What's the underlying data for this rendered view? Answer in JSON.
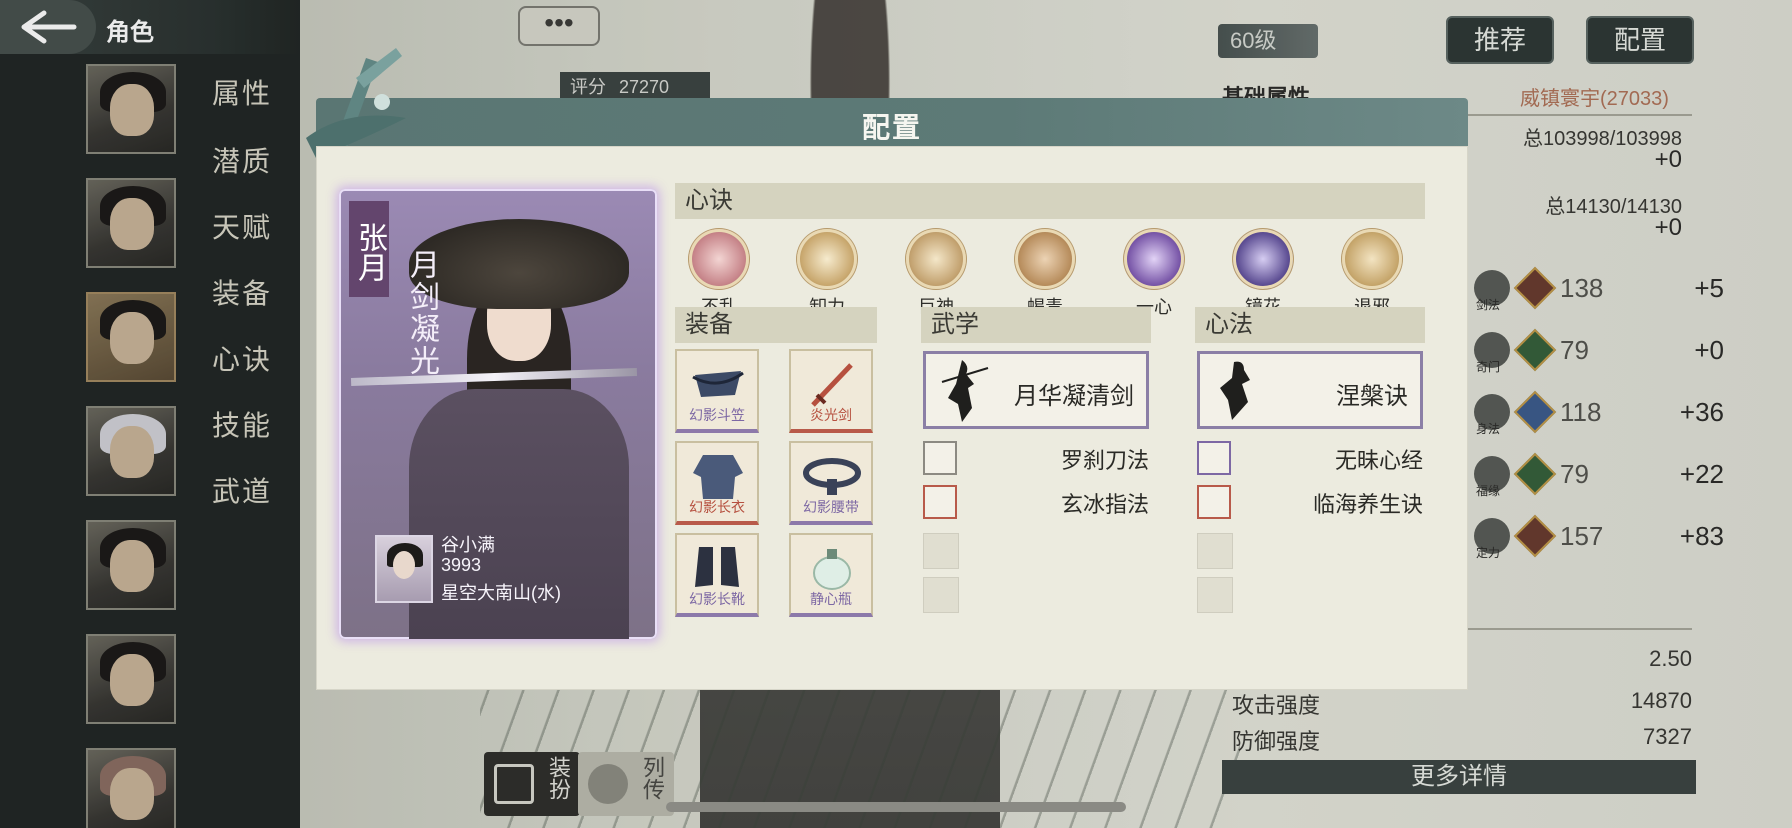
{
  "header": {
    "back_label": "角色"
  },
  "nav": {
    "items": [
      "属性",
      "潜质",
      "天赋",
      "装备",
      "心诀",
      "技能",
      "武道"
    ]
  },
  "stats_panel": {
    "level": "60级",
    "buttons": {
      "recommend": "推荐",
      "config": "配置"
    },
    "section_title": "基础属性",
    "title_right": "威镇寰宇(27033)",
    "rows": [
      {
        "total": "总103998/103998",
        "plus": "+0"
      },
      {
        "total": "总14130/14130",
        "plus": "+0"
      }
    ],
    "skills": [
      {
        "label": "剑法",
        "grade": "甲",
        "value": "138",
        "plus": "+5"
      },
      {
        "label": "奇门",
        "grade": "丙",
        "value": "79",
        "plus": "+0"
      },
      {
        "label": "身法",
        "grade": "",
        "value": "118",
        "plus": "+36"
      },
      {
        "label": "福缘",
        "grade": "丙",
        "value": "79",
        "plus": "+22"
      },
      {
        "label": "定力",
        "grade": "甲",
        "value": "157",
        "plus": "+83"
      }
    ],
    "details": [
      {
        "label": "",
        "value": "2.50"
      },
      {
        "label": "攻击强度",
        "value": "14870"
      },
      {
        "label": "防御强度",
        "value": "7327"
      }
    ],
    "more_details": "更多详情"
  },
  "score": {
    "label": "评分",
    "value": "27270"
  },
  "bottom_tabs": {
    "dress": "装扮",
    "biography": "列传"
  },
  "modal": {
    "title": "配置",
    "character": {
      "name": "张月",
      "title": "月剑凝光",
      "owner_name": "谷小满",
      "owner_id": "3993",
      "owner_server": "星空大南山(水)"
    },
    "xinjue": {
      "header": "心诀",
      "items": [
        {
          "name": "不乱",
          "color": "#c7858a"
        },
        {
          "name": "卸力",
          "color": "#c9a86f"
        },
        {
          "name": "巨神",
          "color": "#c3a270"
        },
        {
          "name": "蝎毒",
          "color": "#b88e5e"
        },
        {
          "name": "一心",
          "color": "#7a58a9"
        },
        {
          "name": "镜花",
          "color": "#5e4f94"
        },
        {
          "name": "退邪",
          "color": "#c6a66c"
        }
      ]
    },
    "equipment": {
      "header": "装备",
      "items": [
        {
          "name": "幻影斗笠",
          "color": "#7d68a4"
        },
        {
          "name": "炎光剑",
          "color": "#b6503f"
        },
        {
          "name": "幻影长衣",
          "color": "#b6503f"
        },
        {
          "name": "幻影腰带",
          "color": "#7d68a4"
        },
        {
          "name": "幻影长靴",
          "color": "#7d68a4"
        },
        {
          "name": "静心瓶",
          "color": "#7d68a4"
        }
      ]
    },
    "wuxue": {
      "header": "武学",
      "main": "月华凝清剑",
      "subs": [
        "罗刹刀法",
        "玄冰指法"
      ]
    },
    "xinfa": {
      "header": "心法",
      "main": "涅槃诀",
      "subs": [
        "无昧心经",
        "临海养生诀"
      ]
    }
  }
}
